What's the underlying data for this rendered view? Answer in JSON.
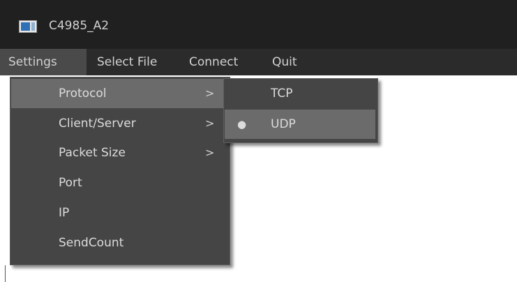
{
  "window": {
    "title": "C4985_A2"
  },
  "menubar": {
    "items": [
      {
        "label": "Settings"
      },
      {
        "label": "Select File"
      },
      {
        "label": "Connect"
      },
      {
        "label": "Quit"
      }
    ]
  },
  "settings_menu": {
    "items": [
      {
        "label": "Protocol",
        "arrow": ">"
      },
      {
        "label": "Client/Server",
        "arrow": ">"
      },
      {
        "label": "Packet Size",
        "arrow": ">"
      },
      {
        "label": "Port"
      },
      {
        "label": "IP"
      },
      {
        "label": "SendCount"
      }
    ]
  },
  "protocol_submenu": {
    "items": [
      {
        "label": "TCP"
      },
      {
        "label": "UDP",
        "bullet": "●"
      }
    ]
  },
  "icons": {
    "app_icon": "application-window-icon",
    "submenu_arrow": "chevron-right-icon",
    "radio_bullet": "bullet-icon"
  }
}
